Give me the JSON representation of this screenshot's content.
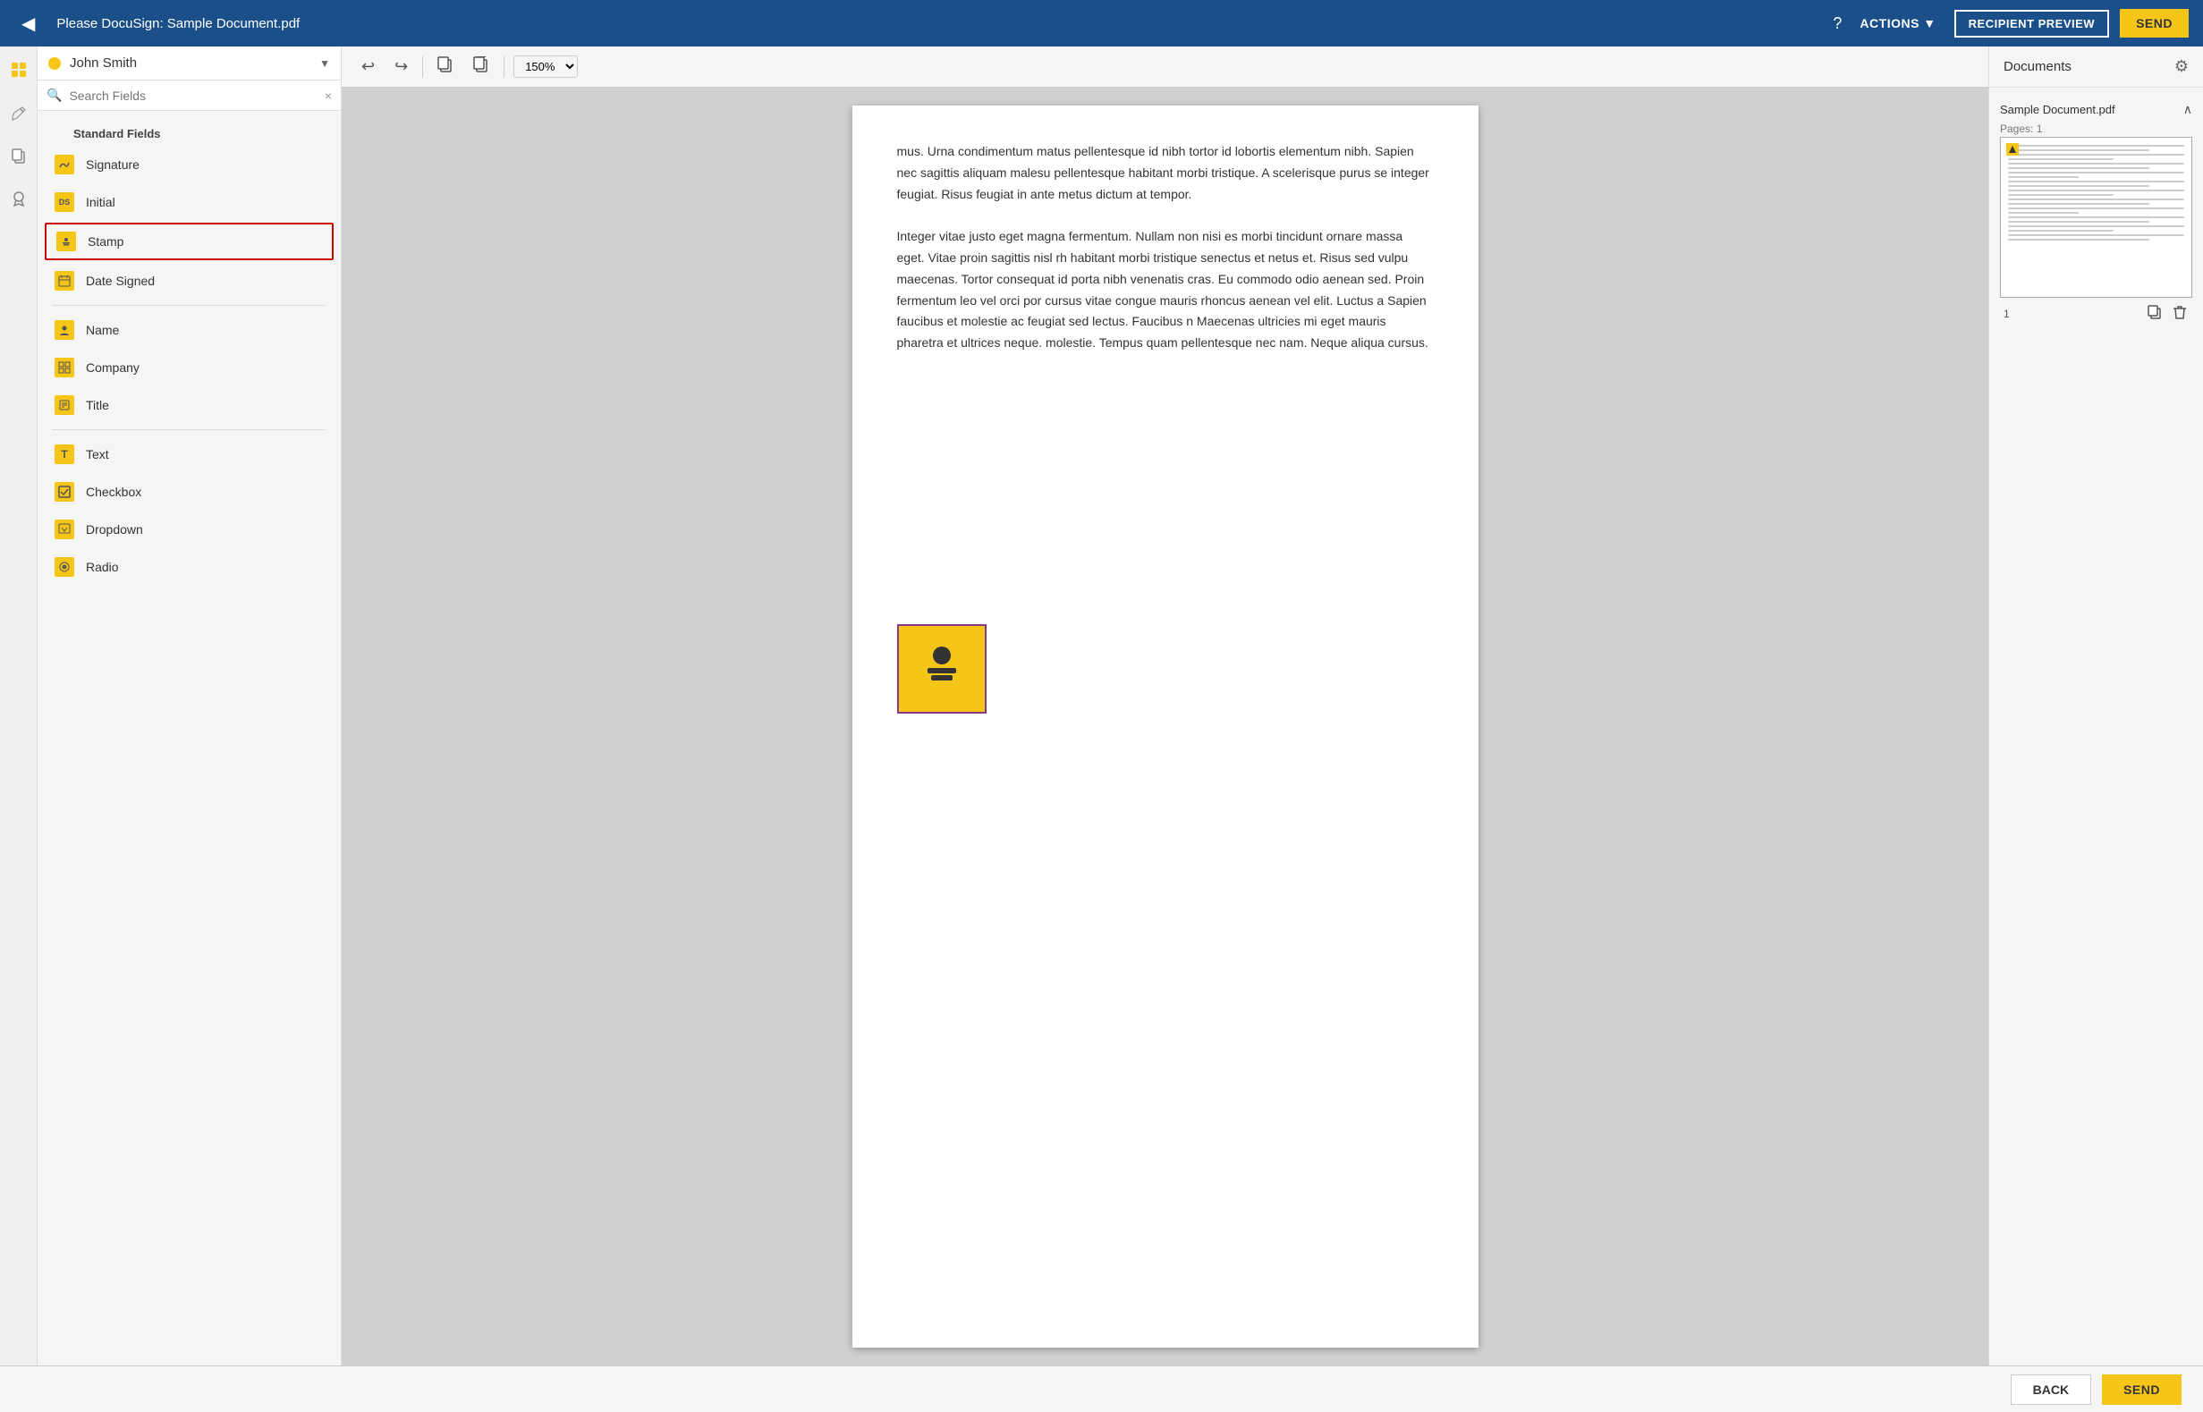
{
  "header": {
    "back_label": "◀",
    "title": "Please DocuSign: Sample Document.pdf",
    "help_icon": "?",
    "actions_label": "ACTIONS ▼",
    "recipient_preview_label": "RECIPIENT PREVIEW",
    "send_label": "SEND"
  },
  "sidebar": {
    "recipient": {
      "name": "John Smith",
      "arrow": "▼"
    },
    "search_placeholder": "Search Fields",
    "clear_icon": "×",
    "sections": [
      {
        "label": "Standard Fields",
        "fields": [
          {
            "name": "Signature",
            "icon_type": "pen",
            "highlighted": false
          },
          {
            "name": "Initial",
            "icon_type": "ds",
            "highlighted": false
          },
          {
            "name": "Stamp",
            "icon_type": "stamp",
            "highlighted": true
          },
          {
            "name": "Date Signed",
            "icon_type": "calendar",
            "highlighted": false
          }
        ]
      },
      {
        "label": "",
        "fields": [
          {
            "name": "Name",
            "icon_type": "person",
            "highlighted": false
          },
          {
            "name": "Company",
            "icon_type": "grid",
            "highlighted": false
          },
          {
            "name": "Title",
            "icon_type": "case",
            "highlighted": false
          }
        ]
      },
      {
        "label": "",
        "fields": [
          {
            "name": "Text",
            "icon_type": "T",
            "highlighted": false
          },
          {
            "name": "Checkbox",
            "icon_type": "check",
            "highlighted": false
          },
          {
            "name": "Dropdown",
            "icon_type": "dropdown",
            "highlighted": false
          },
          {
            "name": "Radio",
            "icon_type": "radio",
            "highlighted": false
          }
        ]
      }
    ]
  },
  "toolbar": {
    "undo": "↩",
    "redo": "↪",
    "copy": "⧉",
    "paste": "⧉",
    "zoom": "150%"
  },
  "document": {
    "content": "mus. Urna condimentum matus pellentesque id nibh tortor id lobortis elementum nibh. Sapien nec sagittis aliquam malesu pellentesque habitant morbi tristique. A scelerisque purus se integer feugiat. Risus feugiat in ante metus dictum at tempor.\n\nInteger vitae justo eget magna fermentum. Nullam non nisi es morbi tincidunt ornare massa eget. Vitae proin sagittis nisl rh habitant morbi tristique senectus et netus et. Risus sed vulpu maecenas. Tortor consequat id porta nibh venenatis cras. Eu commodo odio aenean sed. Proin fermentum leo vel orci por cursus vitae congue mauris rhoncus aenean vel elit. Luctus a Sapien faucibus et molestie ac feugiat sed lectus. Faucibus n Maecenas ultricies mi eget mauris pharetra et ultrices neque. molestie. Tempus quam pellentesque nec nam. Neque aliqua cursus."
  },
  "right_panel": {
    "title": "Documents",
    "gear_icon": "⚙",
    "docs": [
      {
        "name": "Sample Document.pdf",
        "pages_label": "Pages: 1",
        "expand_icon": "∧",
        "page_num": "1"
      }
    ]
  },
  "bottom_bar": {
    "back_label": "BACK",
    "send_label": "SEND"
  }
}
